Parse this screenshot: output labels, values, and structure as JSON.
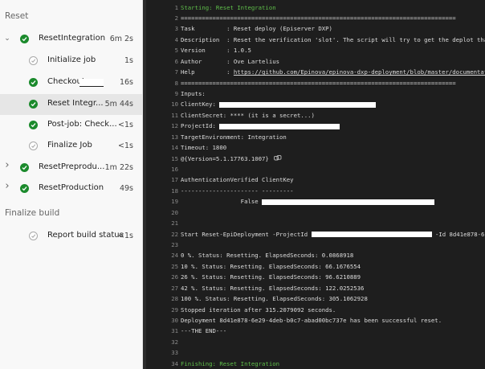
{
  "sidebar": {
    "section_reset": "Reset",
    "section_finalize": "Finalize build",
    "items": [
      {
        "label": "ResetIntegration",
        "duration": "6m 2s",
        "status": "success",
        "expanded": true,
        "level": 0
      },
      {
        "label": "Initialize job",
        "duration": "1s",
        "status": "skipped",
        "level": 1
      },
      {
        "label": "Checkout",
        "duration": "16s",
        "status": "success",
        "level": 1,
        "redacted": true
      },
      {
        "label": "Reset Integr...",
        "duration": "5m 44s",
        "status": "success",
        "level": 1,
        "selected": true
      },
      {
        "label": "Post-job: Check...",
        "duration": "<1s",
        "status": "success",
        "level": 1
      },
      {
        "label": "Finalize Job",
        "duration": "<1s",
        "status": "skipped",
        "level": 1
      },
      {
        "label": "ResetPreprodu...",
        "duration": "1m 22s",
        "status": "success",
        "expanded": false,
        "level": 0
      },
      {
        "label": "ResetProduction",
        "duration": "49s",
        "status": "success",
        "expanded": false,
        "level": 0
      },
      {
        "label": "Report build status",
        "duration": "<1s",
        "status": "skipped",
        "level": 1
      }
    ]
  },
  "log": {
    "lines": [
      {
        "n": "1",
        "text": "Starting: Reset Integration",
        "cls": "green"
      },
      {
        "n": "2",
        "text": "=============================================================================="
      },
      {
        "n": "3",
        "text": "Task         : Reset deploy (Episerver DXP)"
      },
      {
        "n": "4",
        "text": "Description  : Reset the verification 'slot'. The script will try to get the deplot that"
      },
      {
        "n": "5",
        "text": "Version      : 1.0.5"
      },
      {
        "n": "6",
        "text": "Author       : Ove Lartelius"
      },
      {
        "n": "7",
        "text": "Help         : ",
        "link": "https://github.com/Epinova/epinova-dxp-deployment/blob/master/documentati"
      },
      {
        "n": "8",
        "text": "=============================================================================="
      },
      {
        "n": "9",
        "text": "Inputs:"
      },
      {
        "n": "10",
        "text": "ClientKey: ",
        "redact": 195
      },
      {
        "n": "11",
        "text": "ClientSecret: **** (it is a secret...)"
      },
      {
        "n": "12",
        "text": "ProjectId: ",
        "redact": 150
      },
      {
        "n": "13",
        "text": "TargetEnvironment: Integration"
      },
      {
        "n": "14",
        "text": "Timeout: 1800"
      },
      {
        "n": "15",
        "text": "@{Version=5.1.17763.1007}",
        "copy": true
      },
      {
        "n": "16",
        "text": ""
      },
      {
        "n": "17",
        "text": "AuthenticationVerified ClientKey"
      },
      {
        "n": "18",
        "text": "---------------------- ---------"
      },
      {
        "n": "19",
        "text": "                 False ",
        "redact": 215
      },
      {
        "n": "20",
        "text": ""
      },
      {
        "n": "21",
        "text": ""
      },
      {
        "n": "22",
        "text": "Start Reset-EpiDeployment -ProjectId ",
        "redact": 150,
        "after": " -Id 8d41e878-6"
      },
      {
        "n": "23",
        "text": ""
      },
      {
        "n": "24",
        "text": "0 %. Status: Resetting. ElapsedSeconds: 0.0868918"
      },
      {
        "n": "25",
        "text": "10 %. Status: Resetting. ElapsedSeconds: 66.1676554"
      },
      {
        "n": "26",
        "text": "26 %. Status: Resetting. ElapsedSeconds: 96.6210889"
      },
      {
        "n": "27",
        "text": "42 %. Status: Resetting. ElapsedSeconds: 122.0252536"
      },
      {
        "n": "28",
        "text": "100 %. Status: Resetting. ElapsedSeconds: 305.1062928"
      },
      {
        "n": "29",
        "text": "Stopped iteration after 315.2079092 seconds."
      },
      {
        "n": "30",
        "text": "Deployment 8d41e878-6e29-4deb-b0c7-abad00bc737e has been successful reset."
      },
      {
        "n": "31",
        "text": "---THE END---"
      },
      {
        "n": "32",
        "text": ""
      },
      {
        "n": "33",
        "text": ""
      },
      {
        "n": "34",
        "text": "Finishing: Reset Integration",
        "cls": "green"
      }
    ]
  },
  "colors": {
    "success": "#1b8a2c",
    "log_bg": "#1e1e1e",
    "green_text": "#5fbf4a"
  }
}
